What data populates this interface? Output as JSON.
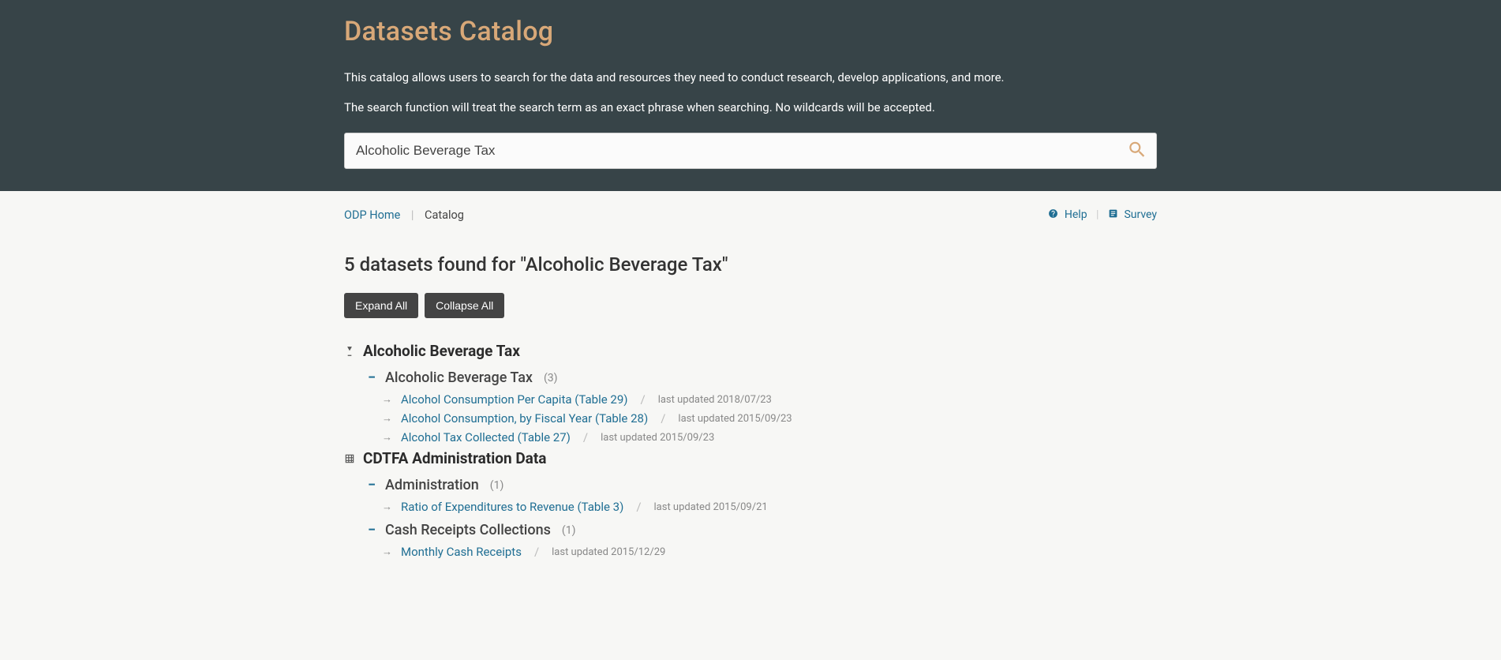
{
  "header": {
    "title": "Datasets Catalog",
    "intro1": "This catalog allows users to search for the data and resources they need to conduct research, develop applications, and more.",
    "intro2": "The search function will treat the search term as an exact phrase when searching. No wildcards will be accepted.",
    "search_value": "Alcoholic Beverage Tax"
  },
  "breadcrumb": {
    "home": "ODP Home",
    "current": "Catalog"
  },
  "util": {
    "help": "Help",
    "survey": "Survey"
  },
  "results": {
    "heading": "5 datasets found for \"Alcoholic Beverage Tax\"",
    "expand_all": "Expand All",
    "collapse_all": "Collapse All"
  },
  "categories": [
    {
      "icon": "glass",
      "title": "Alcoholic Beverage Tax",
      "subcats": [
        {
          "title": "Alcoholic Beverage Tax",
          "count": "(3)",
          "datasets": [
            {
              "name": "Alcohol Consumption Per Capita (Table 29)",
              "updated": "last updated 2018/07/23"
            },
            {
              "name": "Alcohol Consumption, by Fiscal Year (Table 28)",
              "updated": "last updated 2015/09/23"
            },
            {
              "name": "Alcohol Tax Collected (Table 27)",
              "updated": "last updated 2015/09/23"
            }
          ]
        }
      ]
    },
    {
      "icon": "table",
      "title": "CDTFA Administration Data",
      "subcats": [
        {
          "title": "Administration",
          "count": "(1)",
          "datasets": [
            {
              "name": "Ratio of Expenditures to Revenue (Table 3)",
              "updated": "last updated 2015/09/21"
            }
          ]
        },
        {
          "title": "Cash Receipts Collections",
          "count": "(1)",
          "datasets": [
            {
              "name": "Monthly Cash Receipts",
              "updated": "last updated 2015/12/29"
            }
          ]
        }
      ]
    }
  ]
}
